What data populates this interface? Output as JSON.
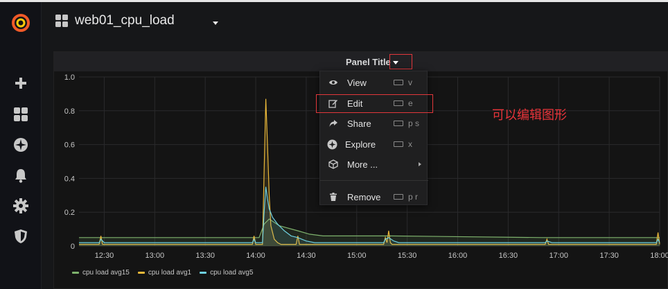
{
  "header": {
    "title": "web01_cpu_load"
  },
  "panel": {
    "title": "Panel Title"
  },
  "menu": {
    "items": [
      {
        "label": "View",
        "icon": "eye-icon",
        "shortcut": "v"
      },
      {
        "label": "Edit",
        "icon": "edit-icon",
        "shortcut": "e"
      },
      {
        "label": "Share",
        "icon": "share-icon",
        "shortcut": "p s"
      },
      {
        "label": "Explore",
        "icon": "compass-icon",
        "shortcut": "x"
      },
      {
        "label": "More ...",
        "icon": "cube-icon",
        "shortcut": ""
      },
      {
        "label": "Remove",
        "icon": "trash-icon",
        "shortcut": "p r"
      }
    ]
  },
  "annotation": "可以编辑图形",
  "sidebar": {
    "icons": [
      "grafana-logo",
      "plus-icon",
      "dashboards-icon",
      "explore-icon",
      "bell-icon",
      "gear-icon",
      "shield-icon"
    ]
  },
  "colors": {
    "avg15": "#7eb26d",
    "avg1": "#eab839",
    "avg5": "#6ed0e0",
    "accent": "#e2373b",
    "logo": "#f05a28"
  },
  "chart_data": {
    "type": "line",
    "ylim": [
      0,
      1.0
    ],
    "y_ticks": [
      "0",
      "0.2",
      "0.4",
      "0.6",
      "0.8",
      "1.0"
    ],
    "x_ticks": [
      "12:30",
      "13:00",
      "13:30",
      "14:00",
      "14:30",
      "15:00",
      "15:30",
      "16:00",
      "16:30",
      "17:00",
      "17:30",
      "18:00"
    ],
    "x_range": [
      "12:15",
      "18:00"
    ],
    "grid": true,
    "legend_position": "bottom-left",
    "series": [
      {
        "name": "cpu load avg15",
        "color": "#7eb26d",
        "points": [
          [
            "12:15",
            0.05
          ],
          [
            "13:50",
            0.05
          ],
          [
            "14:02",
            0.05
          ],
          [
            "14:05",
            0.13
          ],
          [
            "14:08",
            0.16
          ],
          [
            "14:14",
            0.12
          ],
          [
            "14:25",
            0.09
          ],
          [
            "14:32",
            0.07
          ],
          [
            "14:40",
            0.06
          ],
          [
            "15:17",
            0.06
          ],
          [
            "15:20",
            0.06
          ],
          [
            "16:50",
            0.05
          ],
          [
            "18:00",
            0.05
          ]
        ]
      },
      {
        "name": "cpu load avg1",
        "color": "#eab839",
        "points": [
          [
            "12:15",
            0.01
          ],
          [
            "12:27",
            0.01
          ],
          [
            "12:28",
            0.06
          ],
          [
            "12:29",
            0.01
          ],
          [
            "13:58",
            0.01
          ],
          [
            "13:59",
            0.06
          ],
          [
            "14:00",
            0.01
          ],
          [
            "14:04",
            0.01
          ],
          [
            "14:05",
            0.45
          ],
          [
            "14:06",
            0.87
          ],
          [
            "14:07",
            0.6
          ],
          [
            "14:08",
            0.3
          ],
          [
            "14:09",
            0.12
          ],
          [
            "14:11",
            0.04
          ],
          [
            "14:13",
            0.02
          ],
          [
            "14:15",
            0.01
          ],
          [
            "14:24",
            0.01
          ],
          [
            "14:25",
            0.06
          ],
          [
            "14:26",
            0.01
          ],
          [
            "15:16",
            0.01
          ],
          [
            "15:17",
            0.05
          ],
          [
            "15:18",
            0.02
          ],
          [
            "15:19",
            0.09
          ],
          [
            "15:20",
            0.02
          ],
          [
            "15:21",
            0.01
          ],
          [
            "16:52",
            0.01
          ],
          [
            "16:53",
            0.04
          ],
          [
            "16:54",
            0.01
          ],
          [
            "17:58",
            0.01
          ],
          [
            "17:59",
            0.08
          ],
          [
            "18:00",
            0.01
          ]
        ]
      },
      {
        "name": "cpu load avg5",
        "color": "#6ed0e0",
        "points": [
          [
            "12:15",
            0.02
          ],
          [
            "12:27",
            0.02
          ],
          [
            "12:28",
            0.04
          ],
          [
            "12:30",
            0.02
          ],
          [
            "13:58",
            0.02
          ],
          [
            "13:59",
            0.04
          ],
          [
            "14:00",
            0.02
          ],
          [
            "14:04",
            0.02
          ],
          [
            "14:05",
            0.2
          ],
          [
            "14:06",
            0.35
          ],
          [
            "14:07",
            0.28
          ],
          [
            "14:08",
            0.22
          ],
          [
            "14:10",
            0.17
          ],
          [
            "14:13",
            0.13
          ],
          [
            "14:17",
            0.09
          ],
          [
            "14:21",
            0.06
          ],
          [
            "14:25",
            0.05
          ],
          [
            "14:30",
            0.03
          ],
          [
            "14:35",
            0.02
          ],
          [
            "15:16",
            0.02
          ],
          [
            "15:17",
            0.04
          ],
          [
            "15:19",
            0.05
          ],
          [
            "15:22",
            0.03
          ],
          [
            "15:25",
            0.02
          ],
          [
            "16:52",
            0.02
          ],
          [
            "16:53",
            0.03
          ],
          [
            "16:56",
            0.02
          ],
          [
            "17:58",
            0.02
          ],
          [
            "17:59",
            0.04
          ],
          [
            "18:00",
            0.02
          ]
        ]
      }
    ]
  }
}
